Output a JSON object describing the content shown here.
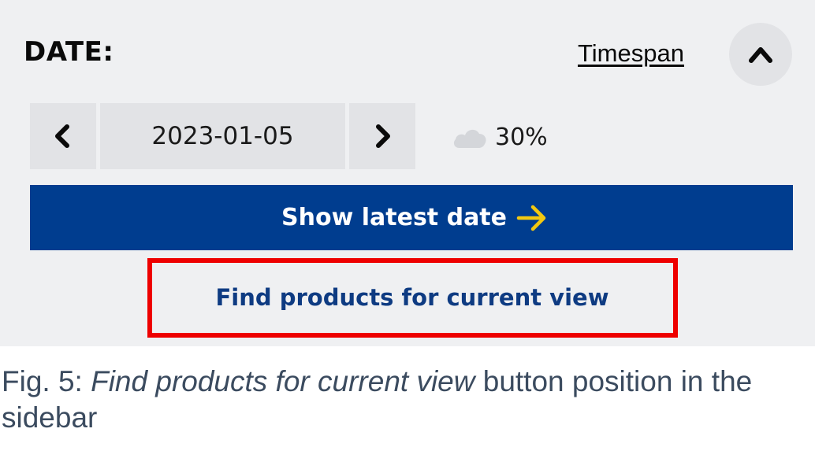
{
  "sidebar": {
    "date_label": "DATE:",
    "timespan_link": "Timespan",
    "collapse_icon": "chevron-up-icon",
    "date_nav": {
      "prev_icon": "chevron-left-icon",
      "date_value": "2023-01-05",
      "next_icon": "chevron-right-icon"
    },
    "cloud_cover": {
      "icon": "cloud-icon",
      "value": "30%"
    },
    "show_latest_button": {
      "label": "Show latest date",
      "icon": "arrow-right-icon"
    },
    "find_products_button": {
      "label": "Find products for current view"
    }
  },
  "caption": {
    "prefix": "Fig. 5: ",
    "emphasis": "Find products for current view",
    "suffix": " button position in the sidebar"
  },
  "colors": {
    "panel_background": "#eff0f2",
    "button_background": "#e2e3e6",
    "primary_blue": "#003d8f",
    "arrow_yellow": "#f2c811",
    "link_blue": "#0e3b82",
    "highlight_red": "#ee0000",
    "caption_text": "#3b4b5f"
  }
}
